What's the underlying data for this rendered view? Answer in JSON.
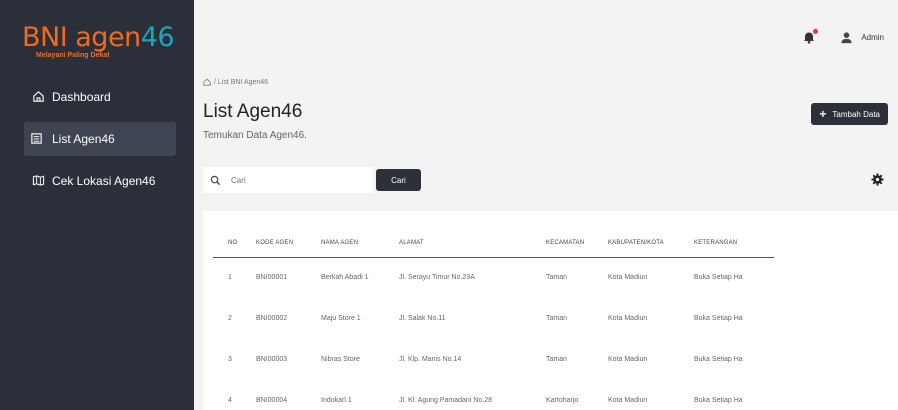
{
  "brand": {
    "name_part1": "BNI ",
    "name_part2": "agen",
    "name_part3": "46",
    "tagline": "Melayani Paling Dekat",
    "accent_color": "#f26b1d",
    "teal_color": "#1aa6b7"
  },
  "sidebar": {
    "items": [
      {
        "label": "Dashboard",
        "icon": "home-icon"
      },
      {
        "label": "List Agen46",
        "icon": "list-icon"
      },
      {
        "label": "Cek Lokasi Agen46",
        "icon": "map-icon"
      }
    ]
  },
  "topbar": {
    "user": "Admin"
  },
  "breadcrumb": {
    "path": "/ List BNI Agen46"
  },
  "page": {
    "title": "List Agen46",
    "subtitle": "Temukan Data Agen46.",
    "add_button": "Tambah Data"
  },
  "search": {
    "placeholder": "Cari",
    "button_label": "Cari"
  },
  "table": {
    "headers": [
      "NO",
      "KODE AGEN",
      "NAMA AGEN",
      "ALAMAT",
      "KECAMATAN",
      "KABUPATEN/KOTA",
      "KETERANGAN"
    ],
    "rows": [
      [
        "1",
        "BNI00001",
        "Berkah Abadi 1",
        "Jl. Serayu Timur No.23A",
        "Taman",
        "Kota Madiun",
        "Buka Setiap Ha"
      ],
      [
        "2",
        "BNI00002",
        "Maju Store 1",
        "Jl. Salak No.11",
        "Taman",
        "Kota Madiun",
        "Buka Setiap Ha"
      ],
      [
        "3",
        "BNI00003",
        "Nibras Store",
        "Jl. Klp. Manis No.14",
        "Taman",
        "Kota Madiun",
        "Buka Setiap Ha"
      ],
      [
        "4",
        "BNI00004",
        "Indokarl 1",
        "Jl. Kl. Agung Pamadani No.28",
        "Kartoharjo",
        "Kota Madiun",
        "Buka Setiap Ha"
      ]
    ]
  }
}
